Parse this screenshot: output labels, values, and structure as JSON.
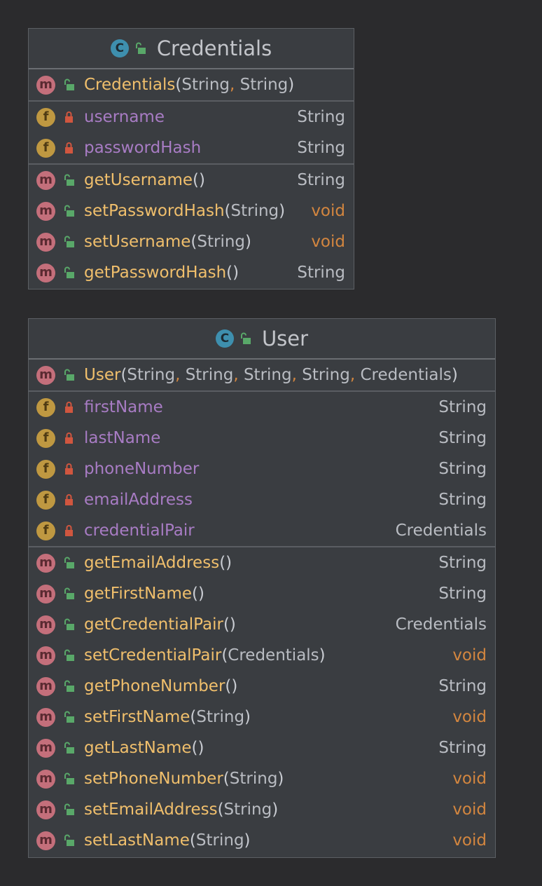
{
  "classes": {
    "credentials": {
      "name": "Credentials",
      "constructor": {
        "name": "Credentials",
        "params": [
          "String",
          "String"
        ]
      },
      "fields": [
        {
          "name": "username",
          "type": "String"
        },
        {
          "name": "passwordHash",
          "type": "String"
        }
      ],
      "methods": [
        {
          "name": "getUsername",
          "params": [],
          "type": "String"
        },
        {
          "name": "setPasswordHash",
          "params": [
            "String"
          ],
          "type": "void"
        },
        {
          "name": "setUsername",
          "params": [
            "String"
          ],
          "type": "void"
        },
        {
          "name": "getPasswordHash",
          "params": [],
          "type": "String"
        }
      ]
    },
    "user": {
      "name": "User",
      "constructor": {
        "name": "User",
        "params": [
          "String",
          "String",
          "String",
          "String",
          "Credentials"
        ]
      },
      "fields": [
        {
          "name": "firstName",
          "type": "String"
        },
        {
          "name": "lastName",
          "type": "String"
        },
        {
          "name": "phoneNumber",
          "type": "String"
        },
        {
          "name": "emailAddress",
          "type": "String"
        },
        {
          "name": "credentialPair",
          "type": "Credentials"
        }
      ],
      "methods": [
        {
          "name": "getEmailAddress",
          "params": [],
          "type": "String"
        },
        {
          "name": "getFirstName",
          "params": [],
          "type": "String"
        },
        {
          "name": "getCredentialPair",
          "params": [],
          "type": "Credentials"
        },
        {
          "name": "setCredentialPair",
          "params": [
            "Credentials"
          ],
          "type": "void"
        },
        {
          "name": "getPhoneNumber",
          "params": [],
          "type": "String"
        },
        {
          "name": "setFirstName",
          "params": [
            "String"
          ],
          "type": "void"
        },
        {
          "name": "getLastName",
          "params": [],
          "type": "String"
        },
        {
          "name": "setPhoneNumber",
          "params": [
            "String"
          ],
          "type": "void"
        },
        {
          "name": "setEmailAddress",
          "params": [
            "String"
          ],
          "type": "void"
        },
        {
          "name": "setLastName",
          "params": [
            "String"
          ],
          "type": "void"
        }
      ]
    }
  },
  "icons": {
    "class_badge": "C",
    "method_badge": "m",
    "field_badge": "f",
    "public": "unlocked-padlock-icon",
    "private": "locked-padlock-icon"
  },
  "colors": {
    "method_name": "#f0bf6c",
    "field_name": "#a87cc4",
    "void_type": "#d3863f",
    "class_badge": "#3e8fae",
    "method_badge": "#c46f7b",
    "field_badge": "#bf9841",
    "public_icon": "#59a869",
    "private_icon": "#d0563f"
  }
}
